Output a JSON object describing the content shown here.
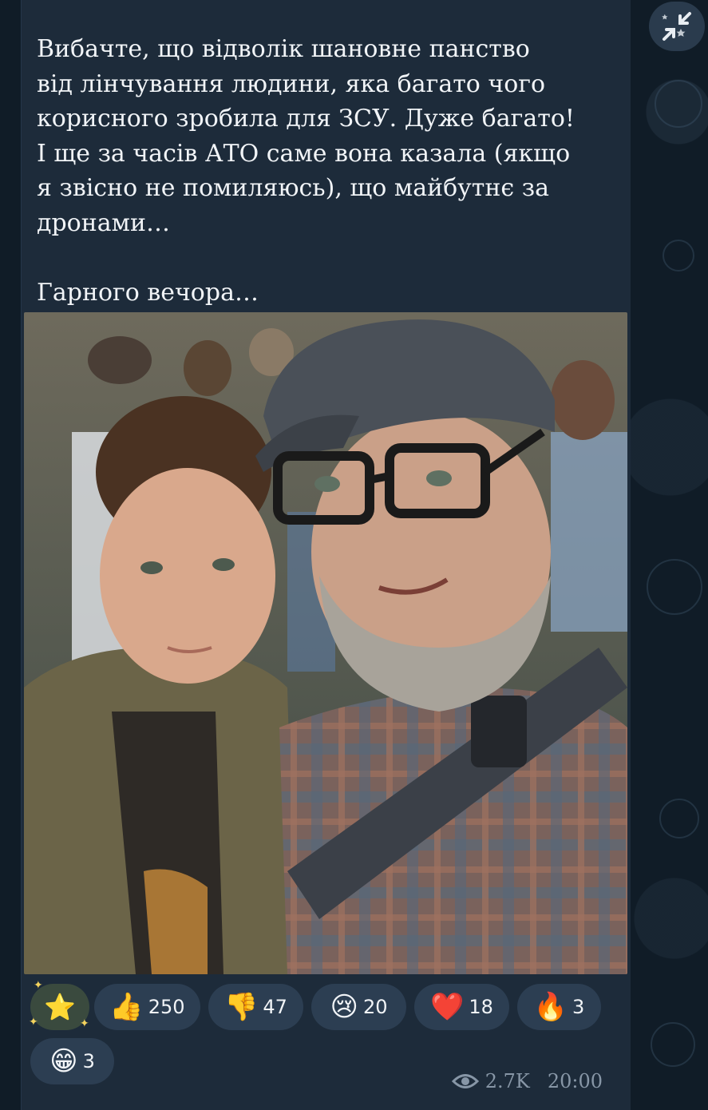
{
  "message": {
    "text": "Вибачте, що відволік шановне панство\nвід лінчування людини, яка багато чого\nкорисного зробила для ЗСУ. Дуже багато!\nІ ще за часів АТО саме вона казала (якщо\nя звісно не помиляюсь), що майбутнє за\nдронами…\n\nГарного вечора…",
    "photo_icon": "photo-of-two-people"
  },
  "reactions": [
    {
      "name": "star",
      "emoji": "⭐",
      "count": ""
    },
    {
      "name": "thumbs-up",
      "emoji": "👍",
      "count": "250"
    },
    {
      "name": "thumbs-down",
      "emoji": "👎",
      "count": "47"
    },
    {
      "name": "crying-face",
      "emoji": "😢",
      "count": "20"
    },
    {
      "name": "red-heart",
      "emoji": "❤️",
      "count": "18"
    },
    {
      "name": "fire",
      "emoji": "🔥",
      "count": "3"
    },
    {
      "name": "grinning-face",
      "emoji": "😁",
      "count": "3"
    }
  ],
  "meta": {
    "views_icon": "eye-icon",
    "views": "2.7K",
    "time": "20:00"
  },
  "collapse_icon": "collapse-arrows-icon",
  "colors": {
    "bubble": "#1d2b3a",
    "background": "#101c27",
    "reaction_pill": "#2c3e52",
    "text": "#f1f4f7",
    "meta_text": "#8796a6"
  }
}
